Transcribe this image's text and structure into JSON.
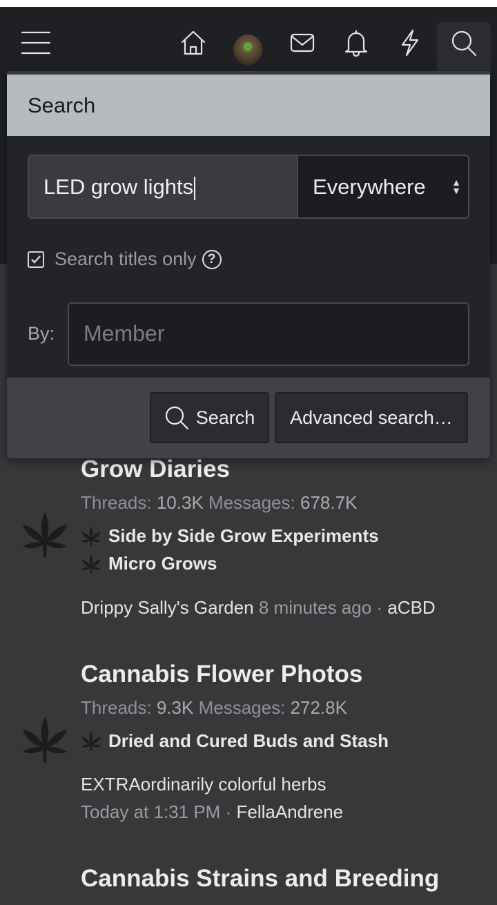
{
  "header": {
    "icons": [
      "menu-icon",
      "home-icon",
      "avatar",
      "envelope-icon",
      "bell-icon",
      "lightning-icon",
      "search-icon"
    ]
  },
  "search_menu": {
    "title": "Search",
    "query": "LED grow lights",
    "scope": "Everywhere",
    "titles_only_label": "Search titles only",
    "titles_only_checked": true,
    "help": "?",
    "by_label": "By:",
    "member_placeholder": "Member",
    "search_button": "Search",
    "advanced_button": "Advanced search…"
  },
  "nodes": [
    {
      "title": "Grow Diaries",
      "threads_label": "Threads:",
      "threads": "10.3K",
      "messages_label": "Messages:",
      "messages": "678.7K",
      "subforums": [
        "Side by Side Grow Experiments",
        "Micro Grows"
      ],
      "last_title": "Drippy Sally's Garden",
      "last_time": "8 minutes ago",
      "sep": "·",
      "last_user": "aCBD"
    },
    {
      "title": "Cannabis Flower Photos",
      "threads_label": "Threads:",
      "threads": "9.3K",
      "messages_label": "Messages:",
      "messages": "272.8K",
      "subforums": [
        "Dried and Cured Buds and Stash"
      ],
      "last_title": "EXTRAordinarily colorful herbs",
      "last_time": "Today at 1:31 PM",
      "sep": "·",
      "last_user": "FellaAndrene"
    },
    {
      "title": "Cannabis Strains and Breeding"
    }
  ],
  "colors": {
    "header": "#1f2024",
    "page": "#38383b",
    "menu_title": "#b6bbbe"
  }
}
